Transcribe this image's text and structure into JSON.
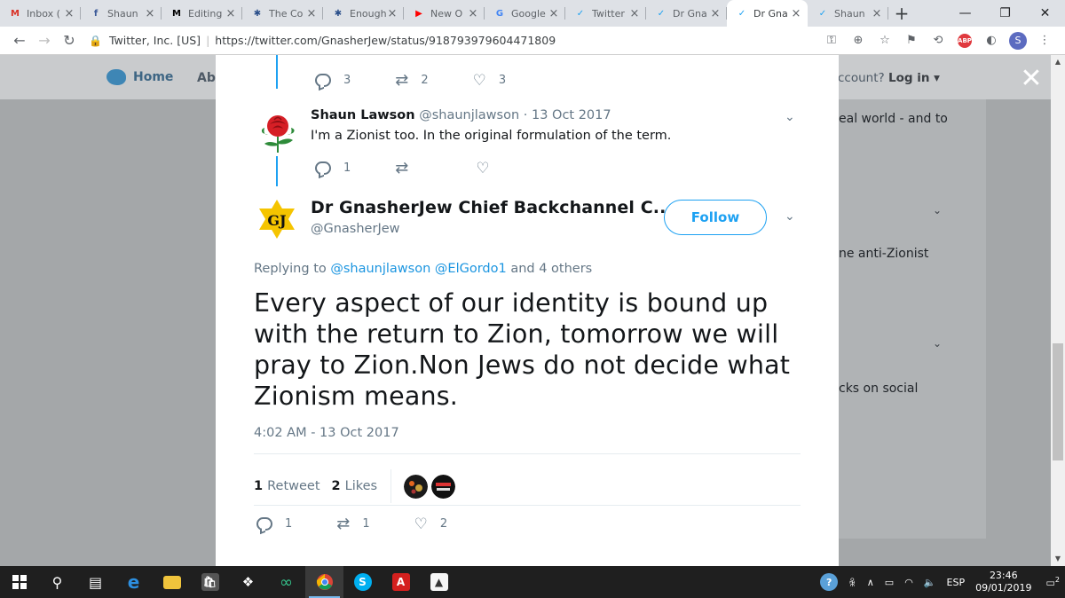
{
  "browser": {
    "tabs": [
      {
        "title": "Inbox (",
        "icon": "gmail-icon",
        "color": "#d93025",
        "glyph": "M"
      },
      {
        "title": "Shaun",
        "icon": "facebook-icon",
        "color": "#3b5998",
        "glyph": "f"
      },
      {
        "title": "Editing",
        "icon": "medium-icon",
        "color": "#000000",
        "glyph": "M"
      },
      {
        "title": "The Co",
        "icon": "butterfly-icon",
        "color": "#2a4f8a",
        "glyph": "✱"
      },
      {
        "title": "Enough",
        "icon": "butterfly-icon",
        "color": "#2a4f8a",
        "glyph": "✱"
      },
      {
        "title": "New O",
        "icon": "youtube-icon",
        "color": "#ff0000",
        "glyph": "▶"
      },
      {
        "title": "Google",
        "icon": "google-translate-icon",
        "color": "#4285f4",
        "glyph": "G"
      },
      {
        "title": "Twitter",
        "icon": "twitter-icon",
        "color": "#1da1f2",
        "glyph": "✓"
      },
      {
        "title": "Dr Gna",
        "icon": "twitter-icon",
        "color": "#1da1f2",
        "glyph": "✓"
      },
      {
        "title": "Dr Gna",
        "icon": "twitter-icon",
        "color": "#1da1f2",
        "glyph": "✓"
      },
      {
        "title": "Shaun",
        "icon": "twitter-icon",
        "color": "#1da1f2",
        "glyph": "✓"
      }
    ],
    "active_tab_index": 9,
    "site_org": "Twitter, Inc. [US]",
    "url": "https://twitter.com/GnasherJew/status/918793979604471809",
    "profile_initial": "S",
    "abp_label": "ABP"
  },
  "background": {
    "nav_home": "Home",
    "nav_about": "Abo",
    "login_prefix": "ccount?",
    "login_label": "Log in",
    "right_snippets": [
      "eal world - and to",
      "ne anti-Zionist",
      "cks on social"
    ]
  },
  "thread": {
    "prev_actions": {
      "replies": "3",
      "retweets": "2",
      "likes": "3"
    },
    "reply": {
      "name": "Shaun Lawson",
      "handle": "@shaunjlawson",
      "date": "· 13 Oct 2017",
      "text": "I'm a Zionist too. In the original formulation of the term.",
      "replies": "1",
      "retweets": "",
      "likes": ""
    }
  },
  "tweet": {
    "author_name": "Dr GnasherJew Chief Backchannel C...",
    "author_handle": "@GnasherJew",
    "follow_label": "Follow",
    "avatar_text": "GJ",
    "replying_prefix": "Replying to",
    "replying_user1": "@shaunjlawson",
    "replying_user2": "@ElGordo1",
    "replying_suffix": "and 4 others",
    "text": "Every aspect of our identity is bound up with the return to Zion, tomorrow we will pray to Zion.Non Jews do not decide what Zionism means.",
    "timestamp": "4:02 AM - 13 Oct 2017",
    "retweet_count": "1",
    "retweet_label": "Retweet",
    "like_count": "2",
    "like_label": "Likes",
    "actions": {
      "replies": "1",
      "retweets": "1",
      "likes": "2"
    }
  },
  "taskbar": {
    "language": "ESP",
    "time": "23:46",
    "date": "09/01/2019",
    "notifications": "2"
  },
  "colors": {
    "twitter_blue": "#1da1f2",
    "link_blue": "#1b95e0",
    "overlay": "#a4a7a9",
    "text_gray": "#657786"
  }
}
